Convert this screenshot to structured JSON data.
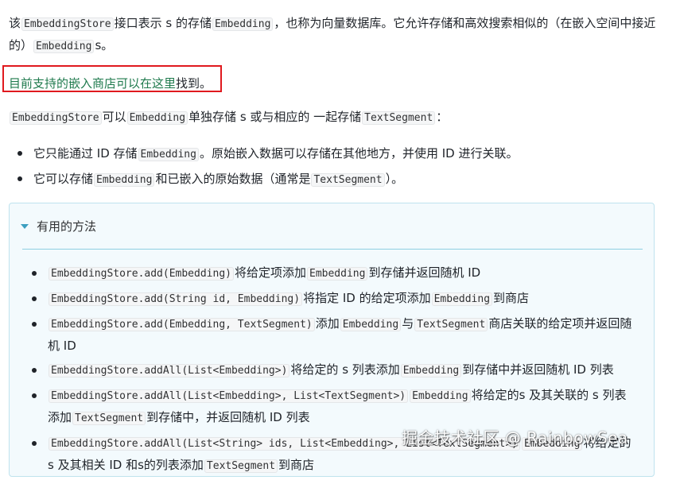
{
  "intro": {
    "t1": "该",
    "c1": "EmbeddingStore",
    "t2": "接口表示 s 的存储",
    "c2": "Embedding",
    "t3": "，也称为向量数据库。它允许存储和高效搜索相似的（在嵌入空间中接近的）",
    "c3": "Embedding",
    "t4": "s。"
  },
  "link_line": {
    "link_text": "目前支持的嵌入商店可以在这里",
    "tail": "找到。"
  },
  "store_desc": {
    "c1": "EmbeddingStore",
    "t1": "可以",
    "c2": "Embedding",
    "t2": "单独存储 s 或与相应的 一起存储",
    "c3": "TextSegment",
    "t3": "："
  },
  "top_list": [
    {
      "t1": "它只能通过 ID 存储",
      "c1": "Embedding",
      "t2": "。原始嵌入数据可以存储在其他地方，并使用 ID 进行关联。"
    },
    {
      "t1": "它可以存储",
      "c1": "Embedding",
      "t2": "和已嵌入的原始数据（通常是",
      "c2": "TextSegment",
      "t3": "）。"
    }
  ],
  "panel": {
    "title": "有用的方法",
    "items": [
      {
        "c1": "EmbeddingStore.add(Embedding)",
        "t1": "将给定项添加",
        "c2": "Embedding",
        "t2": "到存储并返回随机 ID"
      },
      {
        "c1": "EmbeddingStore.add(String id, Embedding)",
        "t1": "将指定 ID 的给定项添加",
        "c2": "Embedding",
        "t2": "到商店"
      },
      {
        "c1": "EmbeddingStore.add(Embedding, TextSegment)",
        "t1": "添加",
        "c2": "Embedding",
        "t2": "与",
        "c3": "TextSegment",
        "t3": "商店关联的给定项并返回随机 ID"
      },
      {
        "c1": "EmbeddingStore.addAll(List<Embedding>)",
        "t1": "将给定的 s 列表添加",
        "c2": "Embedding",
        "t2": "到存储中并返回随机 ID 列表"
      },
      {
        "c1": "EmbeddingStore.addAll(List<Embedding>, List<TextSegment>)",
        "c2": "Embedding",
        "t1": "将给定的s 及其关联的 s 列表添加",
        "c3": "TextSegment",
        "t2": "到存储中，并返回随机 ID 列表"
      },
      {
        "c1": "EmbeddingStore.addAll(List<String> ids, List<Embedding>, List<TextSegment>)",
        "c2": "Embedding",
        "t1": "将给定的s 及其相关 ID 和s的列表添加",
        "c3": "TextSegment",
        "t2": "到商店"
      }
    ]
  },
  "watermark": "掘金技术社区 @ RainbowSea"
}
